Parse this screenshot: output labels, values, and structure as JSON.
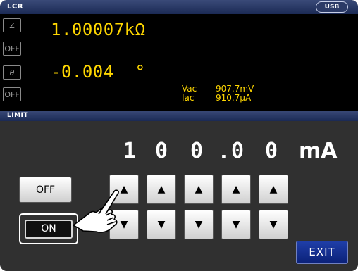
{
  "header": {
    "title": "LCR",
    "usb_badge": "USB"
  },
  "measurement": {
    "param1": "Z",
    "param1_state": "OFF",
    "value1": "1.00007kΩ",
    "param2": "θ",
    "param2_state": "OFF",
    "value2": "-0.004  °",
    "vac_label": "Vac",
    "vac_value": "907.7mV",
    "iac_label": "Iac",
    "iac_value": "910.7µA"
  },
  "limit": {
    "title": "LIMIT",
    "digits": [
      "1",
      "0",
      "0",
      "0",
      "0"
    ],
    "decimal_point": ".",
    "unit": "mA",
    "off_label": "OFF",
    "on_label": "ON",
    "on_selected": true,
    "up_arrow_glyph": "▲",
    "down_arrow_glyph": "▼",
    "exit_label": "EXIT"
  },
  "icons": {
    "pointer": "pointing-hand-icon"
  }
}
